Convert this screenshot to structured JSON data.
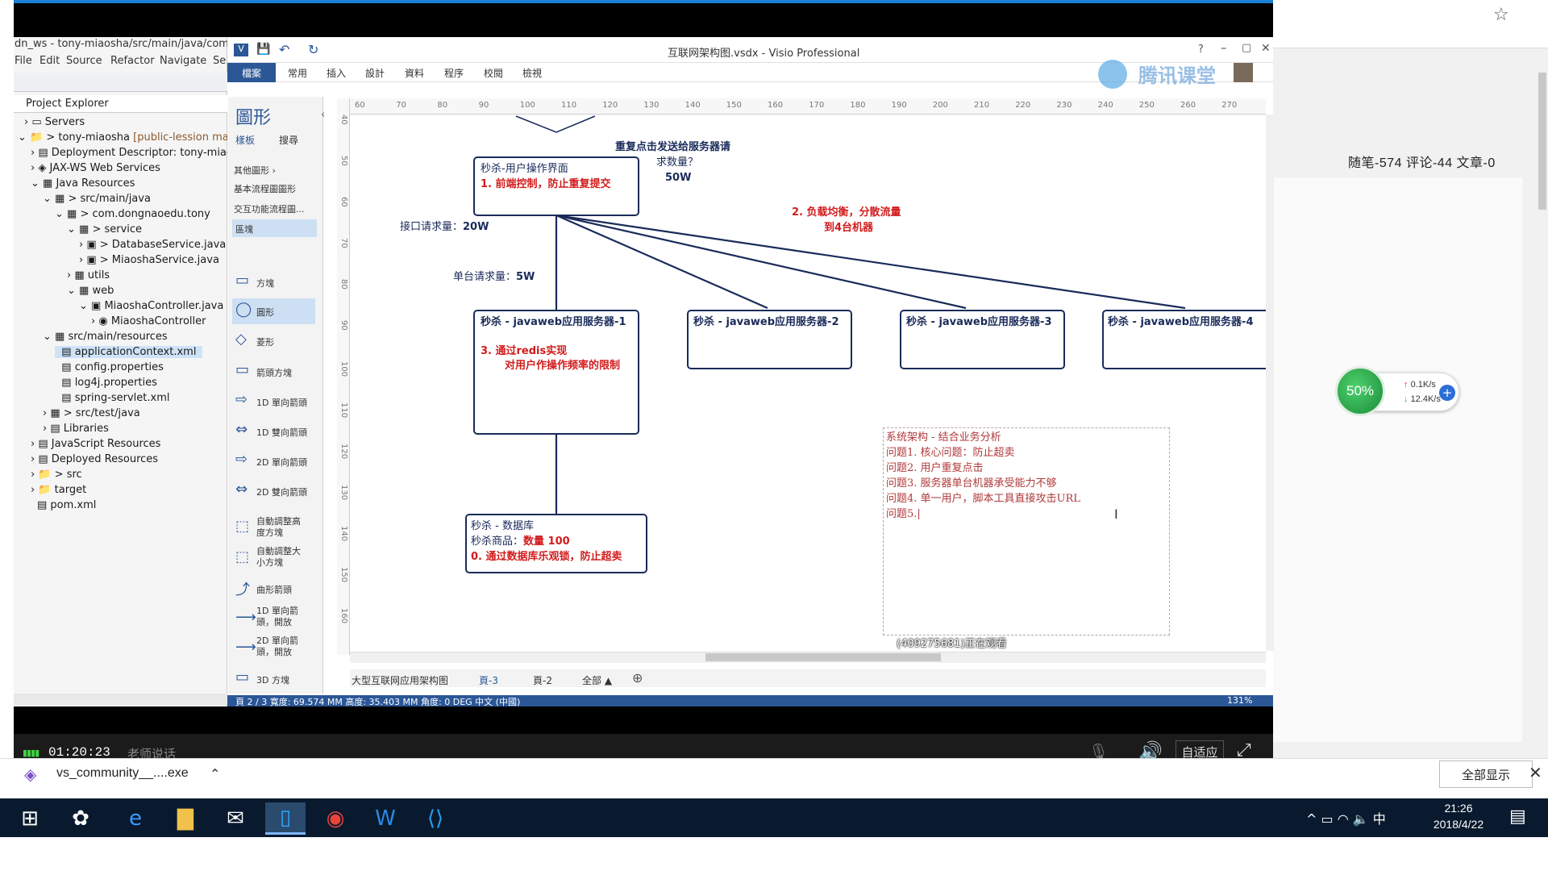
{
  "browser": {
    "blog_stats": "随笔-574  评论-44  文章-0",
    "show_all": "全部显示"
  },
  "netwidget": {
    "percent": "50%",
    "up": "0.1K/s",
    "down": "12.4K/s"
  },
  "player": {
    "time": "01:20:23",
    "teacher": "老师说话",
    "fit": "自适应",
    "viewers": "(409275681)正在观看"
  },
  "download": {
    "filename": "vs_community__....exe"
  },
  "taskbar": {
    "time": "21:26",
    "date": "2018/4/22",
    "ime": "中"
  },
  "eclipse": {
    "title": "dn_ws - tony-miaosha/src/main/java/com/",
    "menu": [
      "File",
      "Edit",
      "Source",
      "Refactor",
      "Navigate",
      "Se"
    ],
    "explorer_label": "Project Explorer",
    "tree": [
      {
        "label": "Servers"
      },
      {
        "label": "tony-miaosha",
        "suffix": "[public-lession master"
      },
      {
        "label": "Deployment Descriptor: tony-miaos"
      },
      {
        "label": "JAX-WS Web Services"
      },
      {
        "label": "Java Resources"
      },
      {
        "label": "src/main/java"
      },
      {
        "label": "com.dongnaoedu.tony"
      },
      {
        "label": "service"
      },
      {
        "label": "DatabaseService.java"
      },
      {
        "label": "MiaoshaService.java"
      },
      {
        "label": "utils"
      },
      {
        "label": "web"
      },
      {
        "label": "MiaoshaController.java"
      },
      {
        "label": "MiaoshaController"
      },
      {
        "label": "src/main/resources"
      },
      {
        "label": "applicationContext.xml"
      },
      {
        "label": "config.properties"
      },
      {
        "label": "log4j.properties"
      },
      {
        "label": "spring-servlet.xml"
      },
      {
        "label": "src/test/java"
      },
      {
        "label": "Libraries"
      },
      {
        "label": "JavaScript Resources"
      },
      {
        "label": "Deployed Resources"
      },
      {
        "label": "src"
      },
      {
        "label": "target"
      },
      {
        "label": "pom.xml"
      }
    ]
  },
  "visio": {
    "title": "互联网架构图.vsdx - Visio Professional",
    "file_tab": "檔案",
    "tabs": [
      "常用",
      "插入",
      "設計",
      "資料",
      "程序",
      "校閱",
      "檢視"
    ],
    "shapes_title": "圖形",
    "shapes_subtabs": [
      "樣板",
      "搜尋"
    ],
    "shapes_groups": [
      "其他圖形",
      "基本流程圖圖形",
      "交互功能流程圖...",
      "區塊"
    ],
    "shapes": [
      "方塊",
      "圓形",
      "菱形",
      "箭頭方塊",
      "1D 單向箭頭",
      "1D 雙向箭頭",
      "2D 單向箭頭",
      "2D 雙向箭頭",
      "自動調整高度方塊",
      "自動調整大小方塊",
      "曲形箭頭",
      "1D 單向箭頭，開放",
      "2D 單向箭頭，開放",
      "3D 方塊"
    ],
    "ruler_marks": [
      "60",
      "70",
      "80",
      "90",
      "100",
      "110",
      "120",
      "130",
      "140",
      "150",
      "160",
      "170",
      "180",
      "190",
      "200",
      "210",
      "220",
      "230",
      "240",
      "250",
      "260",
      "270"
    ],
    "ruler_vmarks": [
      "40",
      "50",
      "60",
      "70",
      "80",
      "90",
      "100",
      "110",
      "120",
      "130",
      "140",
      "150",
      "160"
    ],
    "page_tabs": [
      "大型互联网应用架构图",
      "頁-3",
      "頁-2",
      "全部 ▲"
    ],
    "status": "頁 2 / 3    寬度: 69.574 MM    高度: 35.403 MM    角度: 0 DEG    中文 (中國)",
    "zoom": "131%",
    "logo": "腾讯课堂"
  },
  "diagram": {
    "repeat_click_line1": "重复点击发送给服务器请",
    "repeat_click_line2": "求数量？",
    "repeat_click_value": "50W",
    "ui_box_title": "秒杀-用户操作界面",
    "ui_box_point": "1. 前端控制，防止重复提交",
    "interface_qps_label": "接口请求量：",
    "interface_qps_value": "20W",
    "lb_line1": "2. 负载均衡，分散流量",
    "lb_line2": "到4台机器",
    "single_qps_label": "单台请求量：",
    "single_qps_value": "5W",
    "server1": "秒杀 - javaweb应用服务器-1",
    "server1_point_a": "3. 通过redis实现",
    "server1_point_b": "对用户作操作频率的限制",
    "server2": "秒杀 - javaweb应用服务器-2",
    "server3": "秒杀 - javaweb应用服务器-3",
    "server4": "秒杀 - javaweb应用服务器-4",
    "db_title": "秒杀 - 数据库",
    "db_goods_label": "秒杀商品：",
    "db_goods_value": "数量 100",
    "db_point": "0. 通过数据库乐观锁，防止超卖"
  },
  "notes": [
    "系统架构 - 结合业务分析",
    "问题1. 核心问题：防止超卖",
    "问题2. 用户重复点击",
    "问题3. 服务器单台机器承受能力不够",
    "问题4. 单一用户，脚本工具直接攻击URL",
    "问题5.|"
  ]
}
